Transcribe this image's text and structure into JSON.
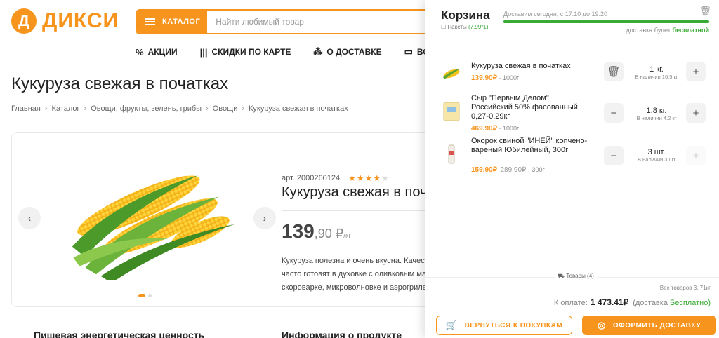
{
  "brand": {
    "logo_letter": "Д",
    "name": "ДИКСИ",
    "color": "#f7941d"
  },
  "search": {
    "catalog_label": "КАТАЛОГ",
    "placeholder": "Найти любимый товар"
  },
  "nav": [
    {
      "icon": "percent-icon",
      "label": "АКЦИИ"
    },
    {
      "icon": "barcode-icon",
      "label": "СКИДКИ ПО КАРТЕ"
    },
    {
      "icon": "delivery-icon",
      "label": "О ДОСТАВКЕ"
    },
    {
      "icon": "chat-icon",
      "label": "ВО"
    }
  ],
  "page": {
    "title": "Кукуруза свежая в початках",
    "breadcrumb": [
      "Главная",
      "Каталог",
      "Овощи, фрукты, зелень, грибы",
      "Овощи",
      "Кукуруза свежая в початках"
    ]
  },
  "product": {
    "article": "арт. 2000260124",
    "rating": 4,
    "name": "Кукуруза свежая в початках",
    "price_int": "139",
    "price_frac": ",90 ₽",
    "price_unit": "/кг",
    "description": [
      "Кукуруза полезна и очень вкусна. Качество",
      "часто готовят в духовке с оливковым маслом",
      "скороварке, микроволновке и аэрогриле"
    ],
    "gallery_dots": 2
  },
  "sections": {
    "energy": "Пищевая энергетическая ценность",
    "info": "Информация о продукте"
  },
  "cart": {
    "title": "Корзина",
    "delivery_time": "Доставим сегодня, с 17:10 до 19:20",
    "bags_label": "Пакеты",
    "bags_value": "(7.99*1)",
    "progress": 1.0,
    "free_prefix": "доставка будет",
    "free_value": "бесплатной",
    "items": [
      {
        "name": "Кукуруза свежая в початках",
        "price": "139.90₽",
        "old_price": "",
        "weight": "· 1000г",
        "qty": "1 кг.",
        "stock": "В наличии 16.5 кг",
        "thumb": "corn"
      },
      {
        "name": "Сыр \"Первым Делом\" Российский 50% фасованный, 0,27-0,29кг",
        "price": "469.90₽",
        "old_price": "",
        "weight": "· 1000г",
        "qty": "1.8 кг.",
        "stock": "В наличии 4.2 кг",
        "thumb": "cheese"
      },
      {
        "name": "Окорок свиной \"ИНЕЙ\" копчено-вареный Юбилейный, 300г",
        "price": "159.90₽",
        "old_price": "289.90₽",
        "weight": "· 300г",
        "qty": "3 шт.",
        "stock": "В наличии 3 шт",
        "thumb": "ham"
      }
    ],
    "goods_count": "Товары (4)",
    "weight_total": "Вес товаров 3. 71кг",
    "total_label": "К оплате:",
    "total_sum": "1 473.41₽",
    "total_note_prefix": "(доставка",
    "total_note_value": "Бесплатно)",
    "back_label": "ВЕРНУТЬСЯ К ПОКУПКАМ",
    "order_label": "ОФОРМИТЬ ДОСТАВКУ"
  }
}
